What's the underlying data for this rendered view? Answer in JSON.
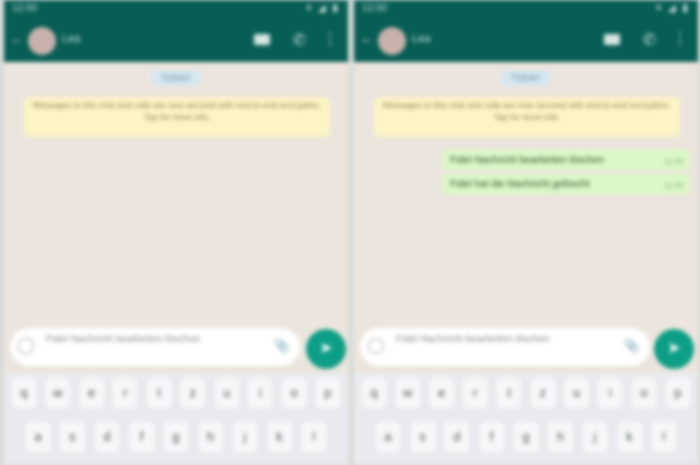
{
  "left": {
    "status": {
      "time": "12:00",
      "icons": "▾ ◢ ▮"
    },
    "appbar": {
      "back": "←",
      "contact_name": "Lea",
      "more": "⋮"
    },
    "date": "TODAY",
    "encryption_notice": "Messages to this chat and calls are now secured with end-to-end encryption. Tap for more info.",
    "input_text": "Fidel Nachricht bearbeiten löschen",
    "send_icon": "➤",
    "keys_row1": [
      "q",
      "w",
      "e",
      "r",
      "t",
      "z",
      "u",
      "i",
      "o",
      "p"
    ],
    "keys_row2": [
      "a",
      "s",
      "d",
      "f",
      "g",
      "h",
      "j",
      "k",
      "l"
    ]
  },
  "right": {
    "status": {
      "time": "12:00",
      "icons": "▾ ◢ ▮"
    },
    "appbar": {
      "back": "←",
      "contact_name": "Lea",
      "more": "⋮"
    },
    "date": "TODAY",
    "encryption_notice": "Messages to this chat and calls are now secured with end-to-end encryption. Tap for more info.",
    "messages": [
      {
        "text": "Fidel Nachricht bearbeiten löschen",
        "time": "12:00"
      },
      {
        "text": "Fidel hat die Nachricht gelöscht",
        "time": "12:00"
      }
    ],
    "input_text": "Fidel Nachricht bearbeiten löschen",
    "send_icon": "➤",
    "keys_row1": [
      "q",
      "w",
      "e",
      "r",
      "t",
      "z",
      "u",
      "i",
      "o",
      "p"
    ],
    "keys_row2": [
      "a",
      "s",
      "d",
      "f",
      "g",
      "h",
      "j",
      "k",
      "l"
    ]
  },
  "colors": {
    "appbar": "#075e54",
    "chat_bg": "#ece5dd",
    "outgoing_bubble": "#dcf8c6",
    "send_button": "#0d9e86",
    "encryption_bg": "#fcf4c4"
  }
}
